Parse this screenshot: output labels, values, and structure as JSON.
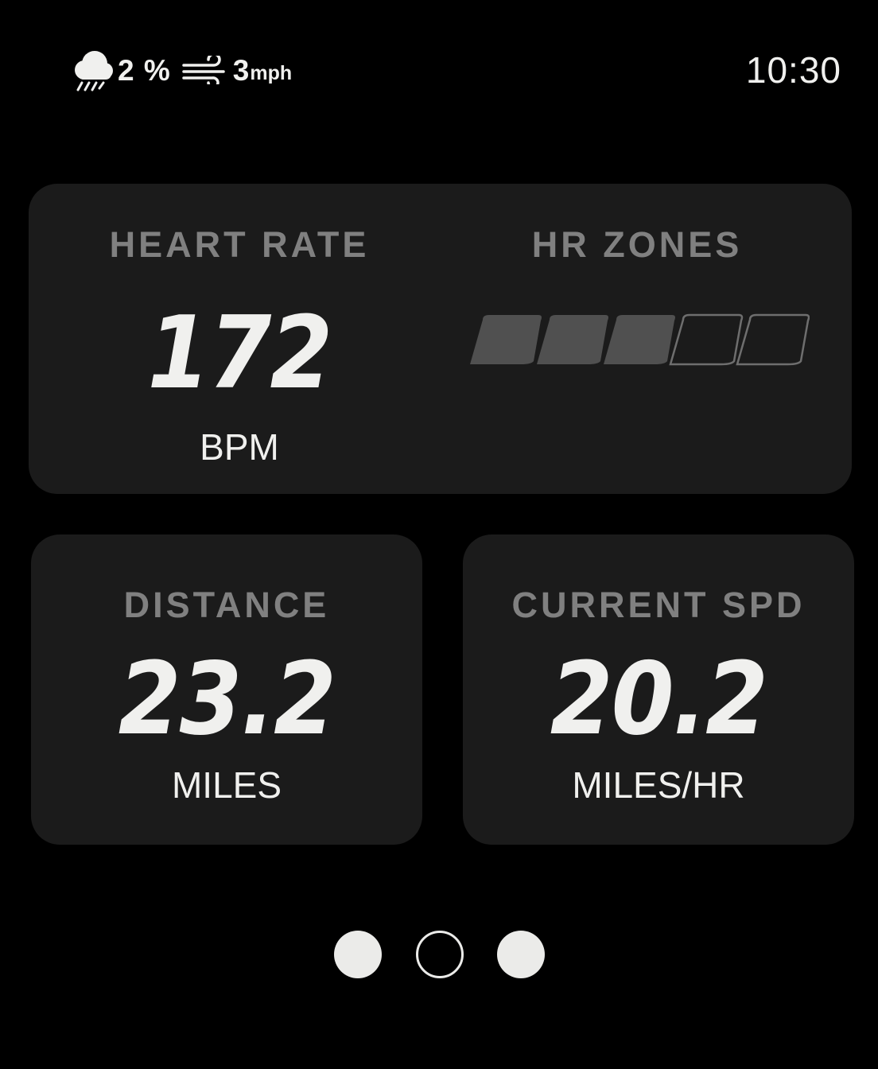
{
  "status_bar": {
    "weather_icon": "rain-cloud-icon",
    "precipitation": "2 %",
    "wind_icon": "wind-icon",
    "wind_speed": "3",
    "wind_unit": "mph",
    "time": "10:30"
  },
  "heart_rate": {
    "label": "HEART RATE",
    "value": "172",
    "unit": "BPM"
  },
  "hr_zones": {
    "label": "HR ZONES",
    "total_zones": 5,
    "active_zones": 3,
    "active_color": "#505050",
    "inactive_border_color": "#6e6e6e"
  },
  "distance": {
    "label": "DISTANCE",
    "value": "23.2",
    "unit": "MILES"
  },
  "current_speed": {
    "label": "CURRENT SPD",
    "value": "20.2",
    "unit": "MILES/HR"
  },
  "pager": {
    "pages": [
      {
        "state": "filled"
      },
      {
        "state": "current"
      },
      {
        "state": "filled"
      }
    ]
  },
  "colors": {
    "background": "#000000",
    "card": "#1b1b1b",
    "label": "#808080",
    "value": "#f0f0ee"
  }
}
